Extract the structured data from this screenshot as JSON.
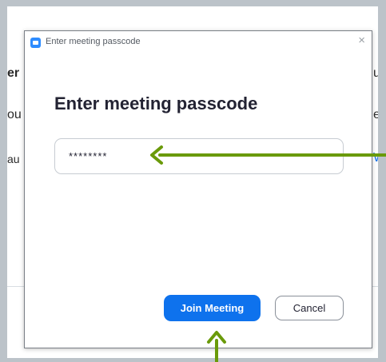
{
  "background_window": {
    "fragments": [
      "er",
      "ou",
      "au",
      "u",
      "e",
      "W"
    ]
  },
  "dialog": {
    "title": "Enter meeting passcode",
    "close_symbol": "×",
    "heading": "Enter meeting passcode",
    "passcode_value": "********",
    "join_label": "Join Meeting",
    "cancel_label": "Cancel"
  },
  "annotations": {
    "arrow_color": "#6a9a0a",
    "arrows": [
      "arrow-pointing-to-passcode-field",
      "arrow-pointing-to-join-button"
    ]
  },
  "colors": {
    "accent": "#0e72ed",
    "app_icon": "#2d8cff"
  },
  "icons": {
    "app": "zoom-app-icon",
    "close": "close-icon"
  }
}
